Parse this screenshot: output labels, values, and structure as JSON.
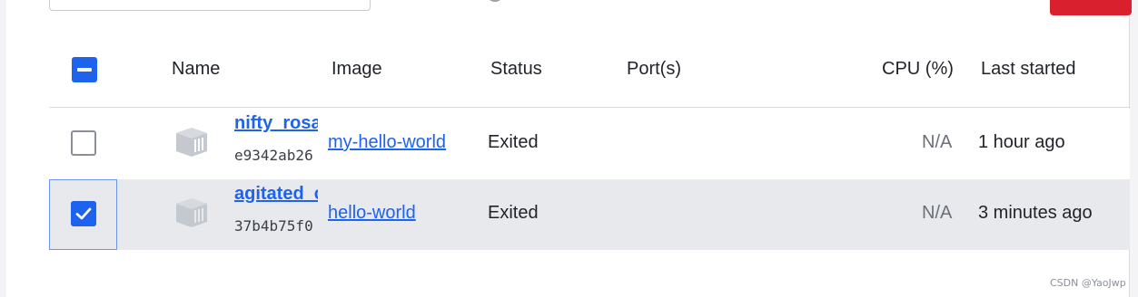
{
  "header": {
    "columns": {
      "name": "Name",
      "image": "Image",
      "status": "Status",
      "ports": "Port(s)",
      "cpu": "CPU (%)",
      "last_started": "Last started"
    }
  },
  "rows": [
    {
      "name": "nifty_rosa",
      "id": "e9342ab26",
      "image": "my-hello-world",
      "status": "Exited",
      "ports": "",
      "cpu": "N/A",
      "last_started": "1 hour ago",
      "checked": false
    },
    {
      "name": "agitated_c",
      "id": "37b4b75f0",
      "image": "hello-world",
      "status": "Exited",
      "ports": "",
      "cpu": "N/A",
      "last_started": "3 minutes ago",
      "checked": true
    }
  ],
  "colors": {
    "accent": "#1d63ed",
    "danger": "#d8202f",
    "selected_row": "#e8e9ed"
  },
  "watermark": "CSDN @YaoJwp"
}
